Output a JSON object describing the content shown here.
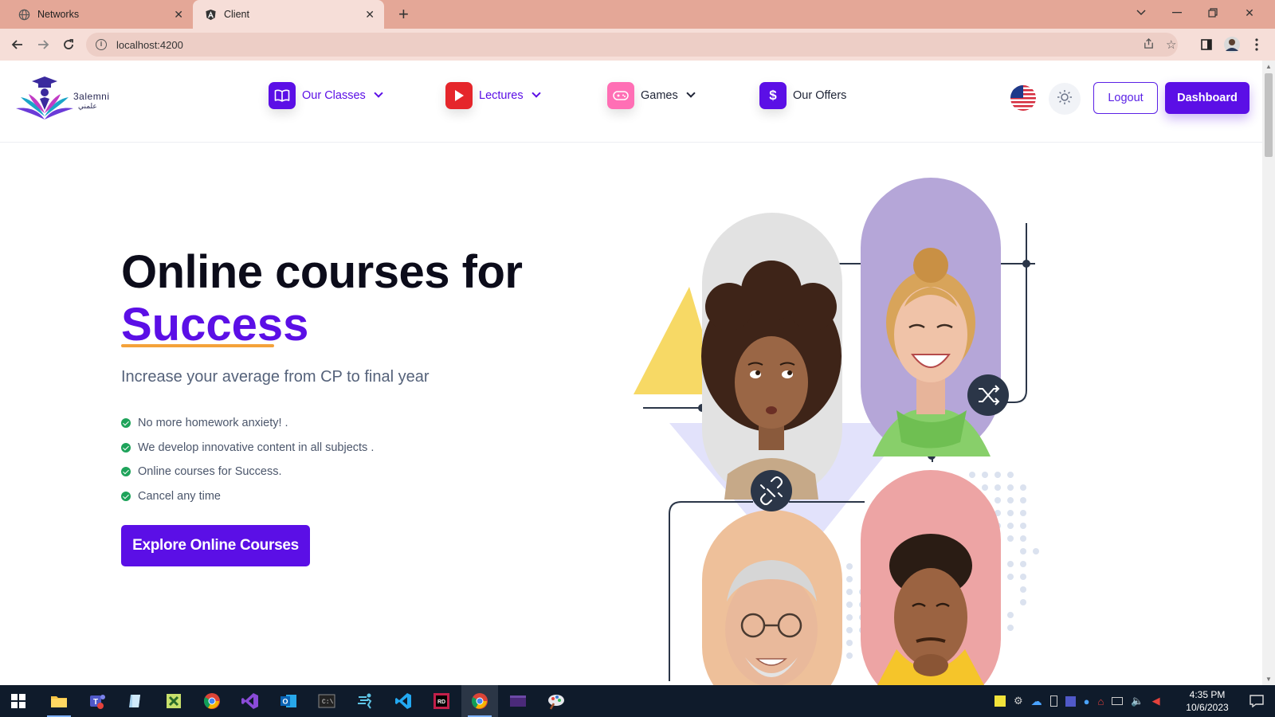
{
  "browser": {
    "tabs": [
      {
        "title": "Networks",
        "active": false,
        "icon": "globe-icon"
      },
      {
        "title": "Client",
        "active": true,
        "icon": "angular-icon"
      }
    ],
    "url": "localhost:4200",
    "colors": {
      "tabbar": "#e4a797",
      "toolbar": "#f6ded8"
    }
  },
  "site": {
    "logo": {
      "name": "3alemni",
      "subtitle": "علمني"
    },
    "nav": [
      {
        "label": "Our Classes",
        "icon": "book-icon",
        "color": "#5b0fe6",
        "has_dropdown": true
      },
      {
        "label": "Lectures",
        "icon": "play-icon",
        "color": "#e5262b",
        "has_dropdown": true
      },
      {
        "label": "Games",
        "icon": "gamepad-icon",
        "color": "#ff6fb5",
        "has_dropdown": true
      },
      {
        "label": "Our Offers",
        "icon": "dollar-icon",
        "color": "#5b0fe6",
        "has_dropdown": false
      }
    ],
    "language_flag": "us-flag-icon",
    "theme_icon": "sun-icon",
    "logout_label": "Logout",
    "dashboard_label": "Dashboard",
    "accent": "#5b0fe6"
  },
  "hero": {
    "title": "Online courses for",
    "highlight": "Success",
    "subtitle": "Increase your average from CP to final year",
    "features": [
      "No more homework anxiety! .",
      "We develop innovative content in all subjects .",
      "Online courses for Success.",
      "Cancel any time"
    ],
    "cta_label": "Explore Online Courses"
  },
  "taskbar": {
    "time": "4:35 PM",
    "date": "10/6/2023"
  }
}
